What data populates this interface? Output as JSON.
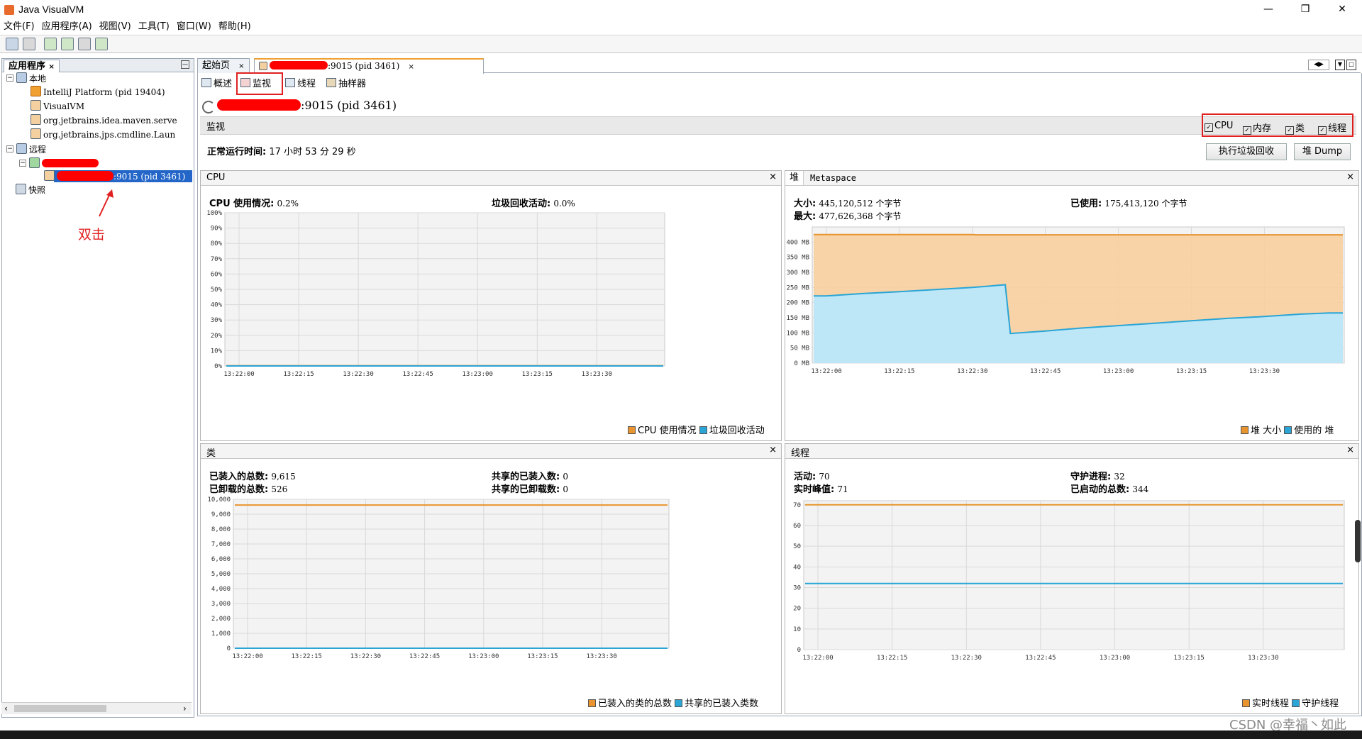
{
  "window": {
    "title": "Java VisualVM"
  },
  "menu": [
    "文件(F)",
    "应用程序(A)",
    "视图(V)",
    "工具(T)",
    "窗口(W)",
    "帮助(H)"
  ],
  "left_panel": {
    "tab": "应用程序",
    "tree": {
      "local": "本地",
      "local_items": [
        "IntelliJ Platform (pid 19404)",
        "VisualVM",
        "org.jetbrains.idea.maven.serve",
        "org.jetbrains.jps.cmdline.Laun"
      ],
      "remote": "远程",
      "remote_item": ":9015 (pid 3461)",
      "snapshots": "快照"
    },
    "annotation": "双击"
  },
  "doc_tabs": [
    "起始页",
    ":9015 (pid 3461)"
  ],
  "sub_tabs": [
    "概述",
    "监视",
    "线程",
    "抽样器"
  ],
  "app_header": ":9015 (pid 3461)",
  "monitor": {
    "label": "监视",
    "checkboxes": [
      "CPU",
      "内存",
      "类",
      "线程"
    ],
    "uptime_label": "正常运行时间:",
    "uptime_value": "17 小时 53 分 29 秒",
    "gc_button": "执行垃圾回收",
    "dump_button": "堆 Dump"
  },
  "cpu_panel": {
    "title": "CPU",
    "usage_label": "CPU 使用情况:",
    "usage_value": "0.2%",
    "gc_label": "垃圾回收活动:",
    "gc_value": "0.0%",
    "legend": [
      "CPU 使用情况",
      "垃圾回收活动"
    ]
  },
  "heap_panel": {
    "tabs": [
      "堆",
      "Metaspace"
    ],
    "size_label": "大小:",
    "size_value": "445,120,512 个字节",
    "max_label": "最大:",
    "max_value": "477,626,368 个字节",
    "used_label": "已使用:",
    "used_value": "175,413,120 个字节",
    "legend": [
      "堆 大小",
      "使用的 堆"
    ]
  },
  "class_panel": {
    "title": "类",
    "loaded_label": "已装入的总数:",
    "loaded_value": "9,615",
    "unloaded_label": "已卸载的总数:",
    "unloaded_value": "526",
    "shared_loaded_label": "共享的已装入数:",
    "shared_loaded_value": "0",
    "shared_unloaded_label": "共享的已卸载数:",
    "shared_unloaded_value": "0",
    "legend": [
      "已装入的类的总数",
      "共享的已装入类数"
    ]
  },
  "thread_panel": {
    "title": "线程",
    "live_label": "活动:",
    "live_value": "70",
    "peak_label": "实时峰值:",
    "peak_value": "71",
    "daemon_label": "守护进程:",
    "daemon_value": "32",
    "started_label": "已启动的总数:",
    "started_value": "344",
    "legend": [
      "实时线程",
      "守护线程"
    ]
  },
  "watermark": "CSDN @幸福丶如此",
  "colors": {
    "orange": "#e8952f",
    "orange_fill": "#f7cf9f",
    "blue": "#2aa5d6",
    "blue_fill": "#bde6f6",
    "highlight": "#e02020",
    "selection": "#2366c8"
  },
  "chart_data": [
    {
      "type": "area",
      "title": "CPU",
      "x": [
        "13:22:00",
        "13:22:15",
        "13:22:30",
        "13:22:45",
        "13:23:00",
        "13:23:15",
        "13:23:30"
      ],
      "yticks": [
        "0%",
        "10%",
        "20%",
        "30%",
        "40%",
        "50%",
        "60%",
        "70%",
        "80%",
        "90%",
        "100%"
      ],
      "ylim": [
        0,
        100
      ],
      "series": [
        {
          "name": "CPU 使用情况",
          "values": [
            0.2,
            0.2,
            0.2,
            0.2,
            0.2,
            0.2,
            0.2
          ]
        },
        {
          "name": "垃圾回收活动",
          "values": [
            0,
            0,
            0,
            0,
            0,
            0,
            0
          ]
        }
      ]
    },
    {
      "type": "area",
      "title": "堆",
      "x": [
        "13:22:00",
        "13:22:15",
        "13:22:30",
        "13:22:45",
        "13:23:00",
        "13:23:15",
        "13:23:30"
      ],
      "yticks": [
        "0 MB",
        "50 MB",
        "100 MB",
        "150 MB",
        "200 MB",
        "250 MB",
        "300 MB",
        "350 MB",
        "400 MB"
      ],
      "ylim": [
        0,
        450
      ],
      "series": [
        {
          "name": "堆 大小",
          "points": [
            [
              0,
              425
            ],
            [
              2.0,
              425
            ],
            [
              2.05,
              424
            ],
            [
              6.9,
              424
            ]
          ]
        },
        {
          "name": "使用的 堆",
          "points": [
            [
              0,
              222
            ],
            [
              0.5,
              230
            ],
            [
              1.0,
              236
            ],
            [
              1.5,
              243
            ],
            [
              2.0,
              250
            ],
            [
              2.45,
              259
            ],
            [
              2.52,
              98
            ],
            [
              3.0,
              106
            ],
            [
              3.5,
              116
            ],
            [
              4.0,
              124
            ],
            [
              4.5,
              132
            ],
            [
              5.0,
              140
            ],
            [
              5.5,
              148
            ],
            [
              6.0,
              154
            ],
            [
              6.5,
              162
            ],
            [
              6.9,
              166
            ]
          ]
        }
      ]
    },
    {
      "type": "line",
      "title": "类",
      "x": [
        "13:22:00",
        "13:22:15",
        "13:22:30",
        "13:22:45",
        "13:23:00",
        "13:23:15",
        "13:23:30"
      ],
      "yticks": [
        "0",
        "1,000",
        "2,000",
        "3,000",
        "4,000",
        "5,000",
        "6,000",
        "7,000",
        "8,000",
        "9,000",
        "10,000"
      ],
      "ylim": [
        0,
        10000
      ],
      "series": [
        {
          "name": "已装入的类的总数",
          "values": [
            9615,
            9615,
            9615,
            9615,
            9615,
            9615,
            9615
          ]
        },
        {
          "name": "共享的已装入类数",
          "values": [
            0,
            0,
            0,
            0,
            0,
            0,
            0
          ]
        }
      ]
    },
    {
      "type": "line",
      "title": "线程",
      "x": [
        "13:22:00",
        "13:22:15",
        "13:22:30",
        "13:22:45",
        "13:23:00",
        "13:23:15",
        "13:23:30"
      ],
      "yticks": [
        "0",
        "10",
        "20",
        "30",
        "40",
        "50",
        "60",
        "70"
      ],
      "ylim": [
        0,
        72
      ],
      "series": [
        {
          "name": "实时线程",
          "values": [
            70,
            70,
            70,
            70,
            70,
            70,
            70
          ]
        },
        {
          "name": "守护线程",
          "values": [
            32,
            32,
            32,
            32,
            32,
            32,
            32
          ]
        }
      ]
    }
  ]
}
